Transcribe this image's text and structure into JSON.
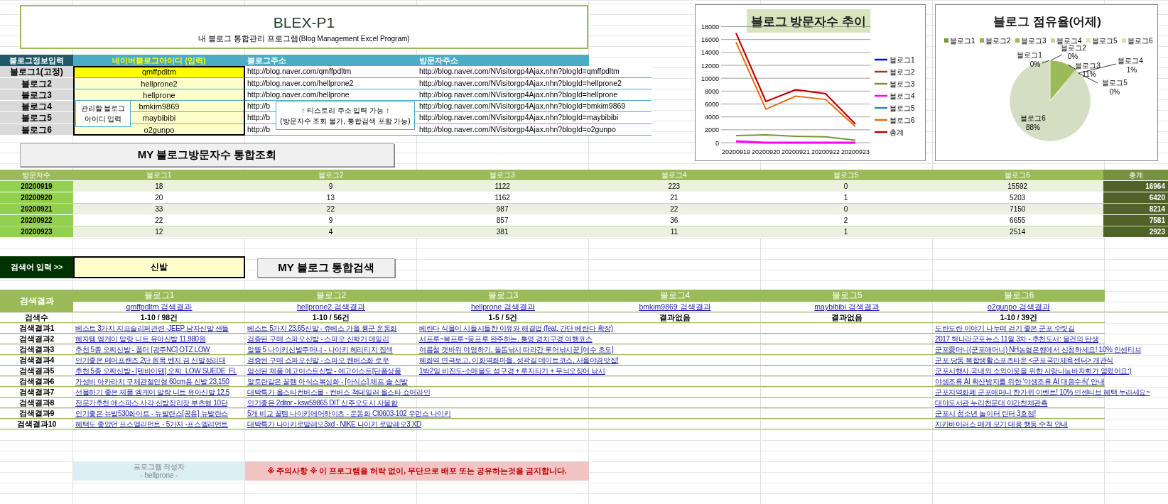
{
  "title_box": {
    "title": "BLEX-P1",
    "subtitle": "내 블로그 통합관리 프로그램",
    "subtitle_note": "(Blog Management  Excel  Program)"
  },
  "blog_info": {
    "columns": [
      "블로그정보입력",
      "네이버블로그아이디 (입력)",
      "블로그주소",
      "방문자주소"
    ],
    "rows": [
      {
        "label": "블로그1(고정)",
        "id": "qmffpdltm",
        "fixed": true,
        "blog_url": "http://blog.naver.com/qmffpdltm",
        "visitor_url": "http://blog.naver.com/NVisitorgp4Ajax.nhn?blogId=qmffpdltm"
      },
      {
        "label": "블로그2",
        "id": "hellprone2",
        "fixed": false,
        "blog_url": "http://blog.naver.com/hellprone2",
        "visitor_url": "http://blog.naver.com/NVisitorgp4Ajax.nhn?blogId=hellprone2"
      },
      {
        "label": "블로그3",
        "id": "hellprone",
        "fixed": false,
        "blog_url": "http://blog.naver.com/hellprone",
        "visitor_url": "http://blog.naver.com/NVisitorgp4Ajax.nhn?blogId=hellprone"
      },
      {
        "label": "블로그4",
        "id": "bmkim9869",
        "fixed": false,
        "blog_url": "http://b",
        "visitor_url": "http://blog.naver.com/NVisitorgp4Ajax.nhn?blogId=bmkim9869"
      },
      {
        "label": "블로그5",
        "id": "maybibibi",
        "fixed": false,
        "blog_url": "http://b",
        "visitor_url": "http://blog.naver.com/NVisitorgp4Ajax.nhn?blogId=maybibibi"
      },
      {
        "label": "블로그6",
        "id": "o2gunpo",
        "fixed": false,
        "blog_url": "http://b",
        "visitor_url": "http://blog.naver.com/NVisitorgp4Ajax.nhn?blogId=o2gunpo"
      }
    ]
  },
  "notes": [
    {
      "text": "관리할 블로그\n아이디 입력"
    },
    {
      "text": "↑ 티스토리 주소 입력 가능 ↑",
      "detail": "(방문자수 조회 불가, 통합검색 포함 가능)"
    }
  ],
  "visit_button": "MY 블로그방문자수 통합조회",
  "line_chart": {
    "chart_data": {
      "type": "line",
      "title": "블로그 방문자수 추이",
      "categories": [
        "20200919",
        "20200920",
        "20200921",
        "20200922",
        "20200923"
      ],
      "series": [
        {
          "name": "블로그1",
          "color": "#0000ff",
          "values": [
            null,
            null,
            null,
            null,
            null
          ]
        },
        {
          "name": "블로그2",
          "color": "#953735",
          "values": [
            null,
            null,
            null,
            null,
            null
          ]
        },
        {
          "name": "블로그3",
          "color": "#77933c",
          "values": [
            1100,
            1200,
            1000,
            900,
            400
          ]
        },
        {
          "name": "블로그4",
          "color": "#ff00ff",
          "values": [
            200,
            0,
            0,
            0,
            0
          ]
        },
        {
          "name": "블로그5",
          "color": "#31859c",
          "values": [
            null,
            null,
            null,
            null,
            null
          ]
        },
        {
          "name": "블로그6",
          "color": "#e46c0a",
          "values": [
            15600,
            5200,
            7200,
            6700,
            2500
          ]
        },
        {
          "name": "총계",
          "color": "#c00000",
          "values": [
            17000,
            6400,
            8200,
            7600,
            2900
          ]
        }
      ],
      "ylim": [
        0,
        18000
      ],
      "yticks": [
        0,
        2000,
        4000,
        6000,
        8000,
        10000,
        12000,
        14000,
        16000,
        18000
      ],
      "grid": true,
      "legend": "right"
    }
  },
  "pie_chart": {
    "chart_data": {
      "type": "pie",
      "title": "블로그 점유율(어제)",
      "categories": [
        "블로그1",
        "블로그2",
        "블로그3",
        "블로그4",
        "블로그5",
        "블로그6"
      ],
      "series": [
        {
          "values": [
            0,
            0,
            11,
            1,
            0,
            88
          ]
        }
      ],
      "value_labels": [
        "0%",
        "0%",
        "11%",
        "1%",
        "0%",
        "88%"
      ],
      "legend": "top"
    }
  },
  "visitor_table": {
    "columns": [
      "방문자수",
      "블로그1",
      "블로그2",
      "블로그3",
      "블로그4",
      "블로그5",
      "블로그6",
      "총계"
    ],
    "rows": [
      [
        "20200919",
        "18",
        "9",
        "1122",
        "223",
        "0",
        "15592",
        "16964"
      ],
      [
        "20200920",
        "20",
        "13",
        "1162",
        "21",
        "1",
        "5203",
        "6420"
      ],
      [
        "20200921",
        "33",
        "22",
        "987",
        "22",
        "0",
        "7150",
        "8214"
      ],
      [
        "20200922",
        "22",
        "9",
        "857",
        "36",
        "2",
        "6655",
        "7581"
      ],
      [
        "20200923",
        "12",
        "4",
        "381",
        "11",
        "1",
        "2514",
        "2923"
      ]
    ]
  },
  "search": {
    "label": "검색어 입력 >>",
    "value": "신발",
    "button": "MY 블로그 통합검색"
  },
  "results": {
    "label": "검색결과",
    "count_label": "검색수",
    "row_labels": [
      "검색결과1",
      "검색결과2",
      "검색결과3",
      "검색결과4",
      "검색결과5",
      "검색결과6",
      "검색결과7",
      "검색결과8",
      "검색결과9",
      "검색결과10"
    ],
    "blogs": [
      {
        "name": "블로그1",
        "link": "qmffpdltm 검색결과",
        "count": "1-10 / 98건",
        "results": [
          "베스트 3가지 지프슬리퍼관련 -JEEP 남자신발 샌들",
          "혜자템 엠케이 말랑 니트 유아신발 11,980원",
          "추천 5종 오찌신발 - 폴더 [광주NC] OTZ LOW",
          "인기좋은 페어프랜즈 2단 원목 벤치 겸 신발정리대",
          "추천 5종 오찌신발 - [텐바이텐] 오찌_LOW SUEDE_FL",
          "가성비 아카라치 구체관절인형 60cm용 신발 23,150",
          "선물하기 좋은 제품 엠케이 말랑 니트 유아신발 12,5",
          "전문가추천 에스파스 사각 신발정리장 부츠형 10단",
          "인기좋은 뉴발530화이트 - 뉴발란스[공용] 뉴발란스",
          "혜택도 좋았던 프스엘리먼트 - 5가지 -프스엘리먼트"
        ]
      },
      {
        "name": "블로그2",
        "link": "hellprone2 검색결과",
        "count": "1-10 / 56건",
        "results": [
          "베스트 5가지 23.65신발 - 쥬베스 가을 룡군 운동화",
          "검증된 구매 스파오신발 - 스파오 신학기 데일리",
          "알뜰 5 나이키신발주머니 - 나이키 헤리티지 짐색",
          "검증된 구매 스파오신발 - 스파오 캔버스화 로우",
          "엄선된 제품 에고이스트신발 - 에고이스트[단품상품",
          "알토란같은 꿀템 아식스복싱화 - [아식스] 체프 솔 신발",
          "대박특가 올스타컨버스몰 - 컨버스 척테일러 올스타 쇼어라인",
          "인기좋은 2ditor - ksw59865 DIT 신주오도시 사물함",
          "5개 비교 꿀템 나이키에어하이츠 - 운동화 CI0603-102 우먼스 나이키",
          "대박특가 나이키로말레오3xd - NIKE 나이키 로말레오3 XD"
        ]
      },
      {
        "name": "블로그3",
        "link": "hellprone 검색결과",
        "count": "1-5 / 5건",
        "results": [
          "베란다 식물이 시들시들한 이유와 해결법 (feat. 간단 베란다 확장)",
          "서프루~북프루~동프루 완주하는, 통영 경치구경 여행코스",
          "여름철 갯바위 야영하기, 돌돔낚시 따라간 루어낚시꾼 [여수 초도]",
          "혜화역 연극보고, 이화벽화마을, 성곽길 데이트코스, 서울야경맛집!",
          "1박2일 비진도-소매물도 섬구경 + 루지타기 + 무늬오징어 낚시"
        ]
      },
      {
        "name": "블로그4",
        "link": "bmkim9869 검색결과",
        "count": "결과없음"
      },
      {
        "name": "블로그5",
        "link": "maybibibi 검색결과",
        "count": "결과없음"
      },
      {
        "name": "블로그6",
        "link": "o2gunpo 검색결과",
        "count": "1-10 / 39건",
        "results": [
          "도란도란 이야기 나누며 걷기 좋은 군포 수릿길",
          "2017 책나라군포뉴스 11월 3차 - 추천도서: 물건의 탄생",
          "군포愛머니(군포애머니) NH농협은행에서 신청하세요! 10% 인센티브",
          "군포 당동 복합생활스포츠타운 <군포국민체육센터> 개관식",
          "군포시행사,국내외 소외이웃을 위한 사랑나눔바자회가 열렸어요:)",
          "야생조류 AI 확산방지를 위한 '야생조류 AI 대응수칙' 안내",
          "군포지역화폐 군포애머니 한가위 이벤트! 10% 인센티브 혜택 누리세요~",
          "대야도서관 누리천문대 야간천체관측",
          "군포시 청소년 놀이터 틴터 3호점!",
          "지카바이러스 매개 모기 대응 행동 수칙 안내"
        ]
      }
    ]
  },
  "footer": {
    "author_title": "프로그램 작성자",
    "author": "- hellprone -",
    "warning": "※ 주의사항 ※ 이 프로그램을 허락 없이, 무단으로 배포 또는 공유하는것을 금지합니다."
  }
}
